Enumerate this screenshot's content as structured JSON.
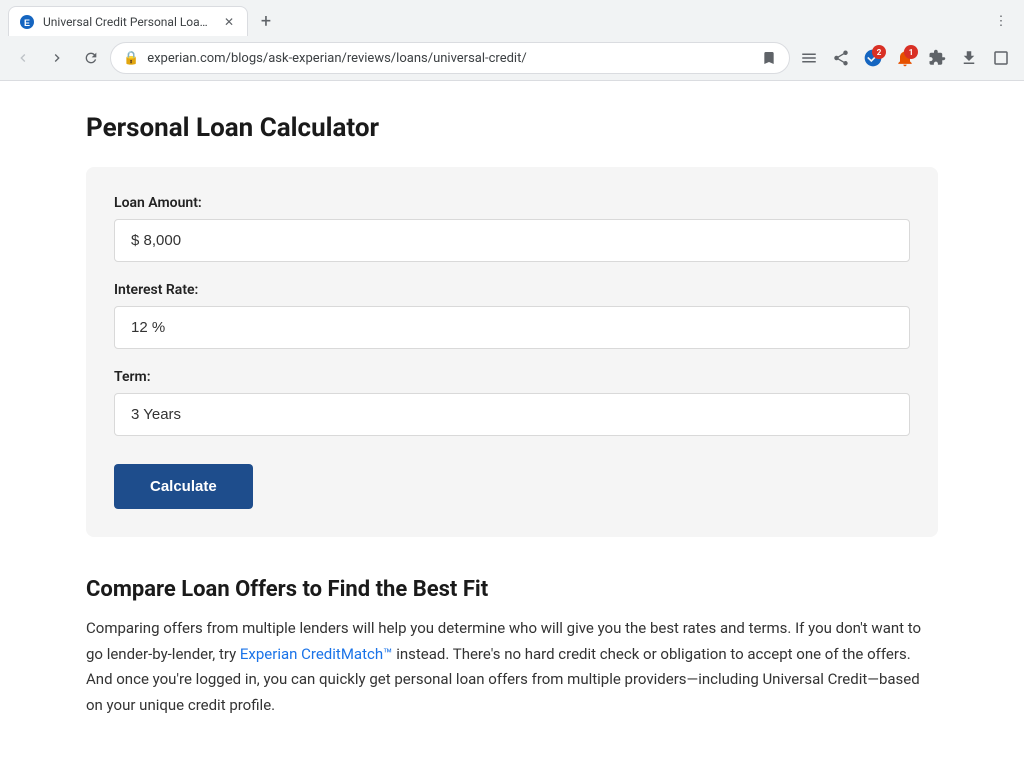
{
  "browser": {
    "tab": {
      "title": "Universal Credit Personal Loan Re",
      "favicon_label": "experian-favicon"
    },
    "new_tab_label": "+",
    "nav": {
      "back_label": "◀",
      "forward_label": "▶",
      "reload_label": "↻",
      "bookmark_label": "☆"
    },
    "address": {
      "lock_icon": "🔒",
      "url": "experian.com/blogs/ask-experian/reviews/loans/universal-credit/"
    },
    "toolbar": {
      "menu_label": "≡",
      "share_label": "↗",
      "extensions_label": "🧩",
      "download_label": "⬇",
      "window_label": "⬜"
    }
  },
  "page": {
    "calculator": {
      "title": "Personal Loan Calculator",
      "loan_amount_label": "Loan Amount:",
      "loan_amount_value": "$8,000",
      "loan_amount_placeholder": "$ 8,000",
      "interest_rate_label": "Interest Rate:",
      "interest_rate_value": "12",
      "interest_rate_placeholder": "12 %",
      "term_label": "Term:",
      "term_value": "3 Years",
      "term_placeholder": "3 Years",
      "calculate_button": "Calculate"
    },
    "compare_section": {
      "title": "Compare Loan Offers to Find the Best Fit",
      "body_1": "Comparing offers from multiple lenders will help you determine who will give you the best rates and terms. If you don't want to go lender-by-lender, try ",
      "link_text": "Experian CreditMatch™",
      "link_url": "#",
      "body_2": " instead. There's no hard credit check or obligation to accept one of the offers. And once you're logged in, you can quickly get personal loan offers from multiple providers—including Universal Credit—based on your unique credit profile."
    }
  }
}
